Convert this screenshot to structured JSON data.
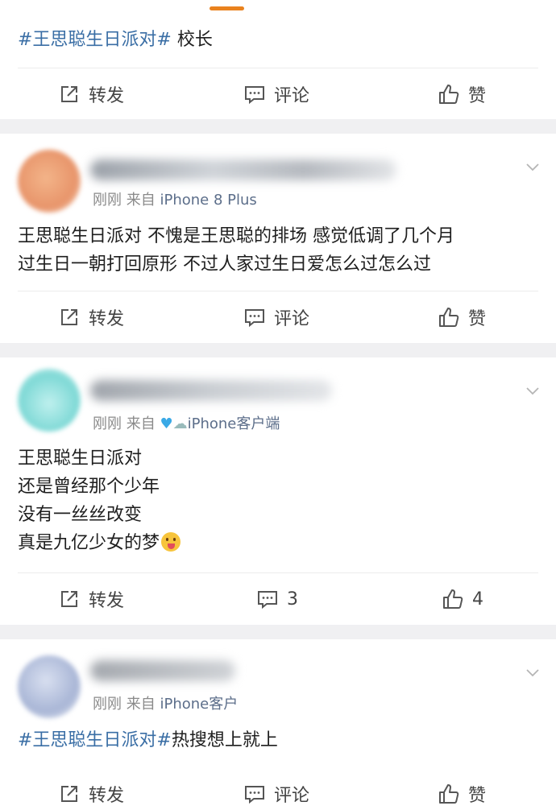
{
  "post1": {
    "topic": "#王思聪生日派对#",
    "text": " 校长"
  },
  "actions_common": {
    "repost": "转发",
    "comment": "评论",
    "like": "赞"
  },
  "post2": {
    "time": "刚刚",
    "from": "来自",
    "source": "iPhone 8 Plus",
    "content": "王思聪生日派对 不愧是王思聪的排场 感觉低调了几个月\n过生日一朝打回原形 不过人家过生日爱怎么过怎么过"
  },
  "post3": {
    "time": "刚刚",
    "from": "来自",
    "source": "iPhone客户端",
    "content_lines": [
      "王思聪生日派对",
      "还是曾经那个少年",
      "没有一丝丝改变",
      "真是九亿少女的梦"
    ],
    "comment_count": "3",
    "like_count": "4"
  },
  "post4": {
    "time": "刚刚",
    "from": "来自",
    "source": "iPhone客户",
    "topic": "#王思聪生日派对#",
    "text": "热搜想上就上"
  },
  "colors": {
    "accent_tab": "#e9821e",
    "topic_link": "#3a6ea5",
    "heart": "#3aa9e6"
  },
  "icons": [
    "repost-icon",
    "comment-icon",
    "like-icon",
    "chevron-down-icon",
    "heart-icon",
    "cloud-icon",
    "emoji-icon"
  ]
}
